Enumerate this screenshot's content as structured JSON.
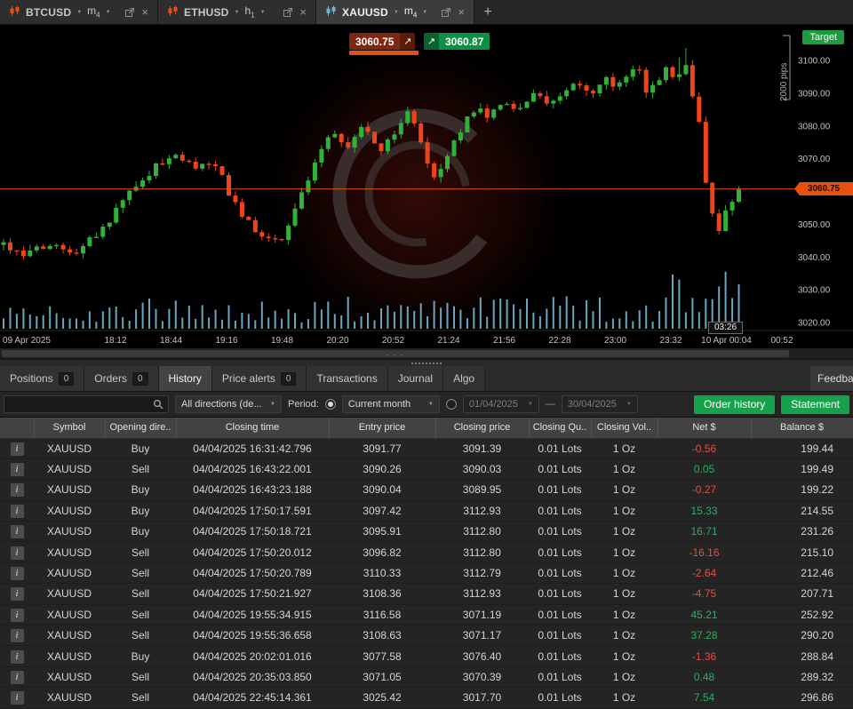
{
  "icons": {
    "chevron_down": "▼",
    "close": "×",
    "new_tab": "+",
    "info": "i",
    "arrow_up_right": "↗"
  },
  "window": {
    "tabs": [
      {
        "symbol": "BTCUSD",
        "period_base": "m",
        "period_sub": "4",
        "icon_color": "#e8500f",
        "active": false
      },
      {
        "symbol": "ETHUSD",
        "period_base": "h",
        "period_sub": "1",
        "icon_color": "#e8500f",
        "active": false
      },
      {
        "symbol": "XAUUSD",
        "period_base": "m",
        "period_sub": "4",
        "icon_color": "#6fb3d2",
        "active": true
      }
    ],
    "new_tab_label": "+"
  },
  "chart": {
    "sell_price": "3060.75",
    "buy_price": "3060.87",
    "target_label": "Target",
    "range_label": "2000 pips",
    "current_price_tag": "3060.75",
    "current_time_tag": "03:26",
    "colors": {
      "up": "#2fb13a",
      "down": "#f0431c",
      "volume": "#7fc2e2",
      "price_line": "#e8500f",
      "axis_text": "#c4c4c4"
    },
    "y_ticks": [
      "3100.00",
      "3090.00",
      "3080.00",
      "3070.00",
      "3060.00",
      "3050.00",
      "3040.00",
      "3030.00",
      "3020.00"
    ],
    "x_ticks": [
      "09 Apr 2025",
      "18:12",
      "18:44",
      "19:16",
      "19:48",
      "20:20",
      "20:52",
      "21:24",
      "21:56",
      "22:28",
      "23:00",
      "23:32",
      "10 Apr 00:04",
      "00:52"
    ],
    "chart_data": {
      "type": "candlestick",
      "symbol": "XAUUSD",
      "timeframe": "m4",
      "y_range": [
        3015,
        3105
      ],
      "current_price": 3060.75,
      "candle_count": 112,
      "price_path": [
        [
          0,
          3045
        ],
        [
          0.025,
          3040
        ],
        [
          0.06,
          3044
        ],
        [
          0.1,
          3042
        ],
        [
          0.14,
          3050
        ],
        [
          0.18,
          3062
        ],
        [
          0.21,
          3068
        ],
        [
          0.235,
          3072
        ],
        [
          0.26,
          3067
        ],
        [
          0.285,
          3070
        ],
        [
          0.31,
          3058
        ],
        [
          0.345,
          3047
        ],
        [
          0.375,
          3044
        ],
        [
          0.4,
          3056
        ],
        [
          0.425,
          3070
        ],
        [
          0.445,
          3078
        ],
        [
          0.47,
          3074
        ],
        [
          0.49,
          3080
        ],
        [
          0.515,
          3072
        ],
        [
          0.535,
          3080
        ],
        [
          0.55,
          3085
        ],
        [
          0.565,
          3077
        ],
        [
          0.585,
          3063
        ],
        [
          0.605,
          3071
        ],
        [
          0.625,
          3080
        ],
        [
          0.645,
          3087
        ],
        [
          0.66,
          3083
        ],
        [
          0.68,
          3088
        ],
        [
          0.7,
          3085
        ],
        [
          0.72,
          3090
        ],
        [
          0.74,
          3086
        ],
        [
          0.76,
          3091
        ],
        [
          0.78,
          3094
        ],
        [
          0.8,
          3089
        ],
        [
          0.815,
          3095
        ],
        [
          0.83,
          3092
        ],
        [
          0.845,
          3096
        ],
        [
          0.862,
          3098
        ],
        [
          0.875,
          3089
        ],
        [
          0.888,
          3094
        ],
        [
          0.9,
          3097
        ],
        [
          0.912,
          3094
        ],
        [
          0.928,
          3098
        ],
        [
          0.945,
          3082
        ],
        [
          0.958,
          3058
        ],
        [
          0.972,
          3047
        ],
        [
          0.985,
          3055
        ],
        [
          1.0,
          3060.75
        ]
      ]
    }
  },
  "panel": {
    "tabs": [
      {
        "label": "Positions",
        "badge": "0"
      },
      {
        "label": "Orders",
        "badge": "0"
      },
      {
        "label": "History",
        "active": true
      },
      {
        "label": "Price alerts",
        "badge": "0"
      },
      {
        "label": "Transactions"
      },
      {
        "label": "Journal"
      },
      {
        "label": "Algo"
      }
    ],
    "feedback_label": "Feedback"
  },
  "filters": {
    "search_value": "",
    "direction_filter": "All directions (de...",
    "period_label": "Period:",
    "period_preset": "Current month",
    "date_from": "01/04/2025",
    "date_to": "30/04/2025",
    "range_separator": "—",
    "order_history_button": "Order history",
    "statement_button": "Statement"
  },
  "history_table": {
    "columns": [
      "",
      "Symbol",
      "Opening dire..",
      "Closing time",
      "Entry price",
      "Closing price",
      "Closing Qu..",
      "Closing Vol..",
      "Net $",
      "Balance $"
    ],
    "rows": [
      [
        "XAUUSD",
        "Buy",
        "04/04/2025 16:31:42.796",
        "3091.77",
        "3091.39",
        "0.01 Lots",
        "1 Oz",
        "-0.56",
        "199.44"
      ],
      [
        "XAUUSD",
        "Sell",
        "04/04/2025 16:43:22.001",
        "3090.26",
        "3090.03",
        "0.01 Lots",
        "1 Oz",
        "0.05",
        "199.49"
      ],
      [
        "XAUUSD",
        "Buy",
        "04/04/2025 16:43:23.188",
        "3090.04",
        "3089.95",
        "0.01 Lots",
        "1 Oz",
        "-0.27",
        "199.22"
      ],
      [
        "XAUUSD",
        "Buy",
        "04/04/2025 17:50:17.591",
        "3097.42",
        "3112.93",
        "0.01 Lots",
        "1 Oz",
        "15.33",
        "214.55"
      ],
      [
        "XAUUSD",
        "Buy",
        "04/04/2025 17:50:18.721",
        "3095.91",
        "3112.80",
        "0.01 Lots",
        "1 Oz",
        "16.71",
        "231.26"
      ],
      [
        "XAUUSD",
        "Sell",
        "04/04/2025 17:50:20.012",
        "3096.82",
        "3112.80",
        "0.01 Lots",
        "1 Oz",
        "-16.16",
        "215.10"
      ],
      [
        "XAUUSD",
        "Sell",
        "04/04/2025 17:50:20.789",
        "3110.33",
        "3112.79",
        "0.01 Lots",
        "1 Oz",
        "-2.64",
        "212.46"
      ],
      [
        "XAUUSD",
        "Sell",
        "04/04/2025 17:50:21.927",
        "3108.36",
        "3112.93",
        "0.01 Lots",
        "1 Oz",
        "-4.75",
        "207.71"
      ],
      [
        "XAUUSD",
        "Sell",
        "04/04/2025 19:55:34.915",
        "3116.58",
        "3071.19",
        "0.01 Lots",
        "1 Oz",
        "45.21",
        "252.92"
      ],
      [
        "XAUUSD",
        "Sell",
        "04/04/2025 19:55:36.658",
        "3108.63",
        "3071.17",
        "0.01 Lots",
        "1 Oz",
        "37.28",
        "290.20"
      ],
      [
        "XAUUSD",
        "Buy",
        "04/04/2025 20:02:01.016",
        "3077.58",
        "3076.40",
        "0.01 Lots",
        "1 Oz",
        "-1.36",
        "288.84"
      ],
      [
        "XAUUSD",
        "Sell",
        "04/04/2025 20:35:03.850",
        "3071.05",
        "3070.39",
        "0.01 Lots",
        "1 Oz",
        "0.48",
        "289.32"
      ],
      [
        "XAUUSD",
        "Sell",
        "04/04/2025 22:45:14.361",
        "3025.42",
        "3017.70",
        "0.01 Lots",
        "1 Oz",
        "7.54",
        "296.86"
      ]
    ]
  }
}
